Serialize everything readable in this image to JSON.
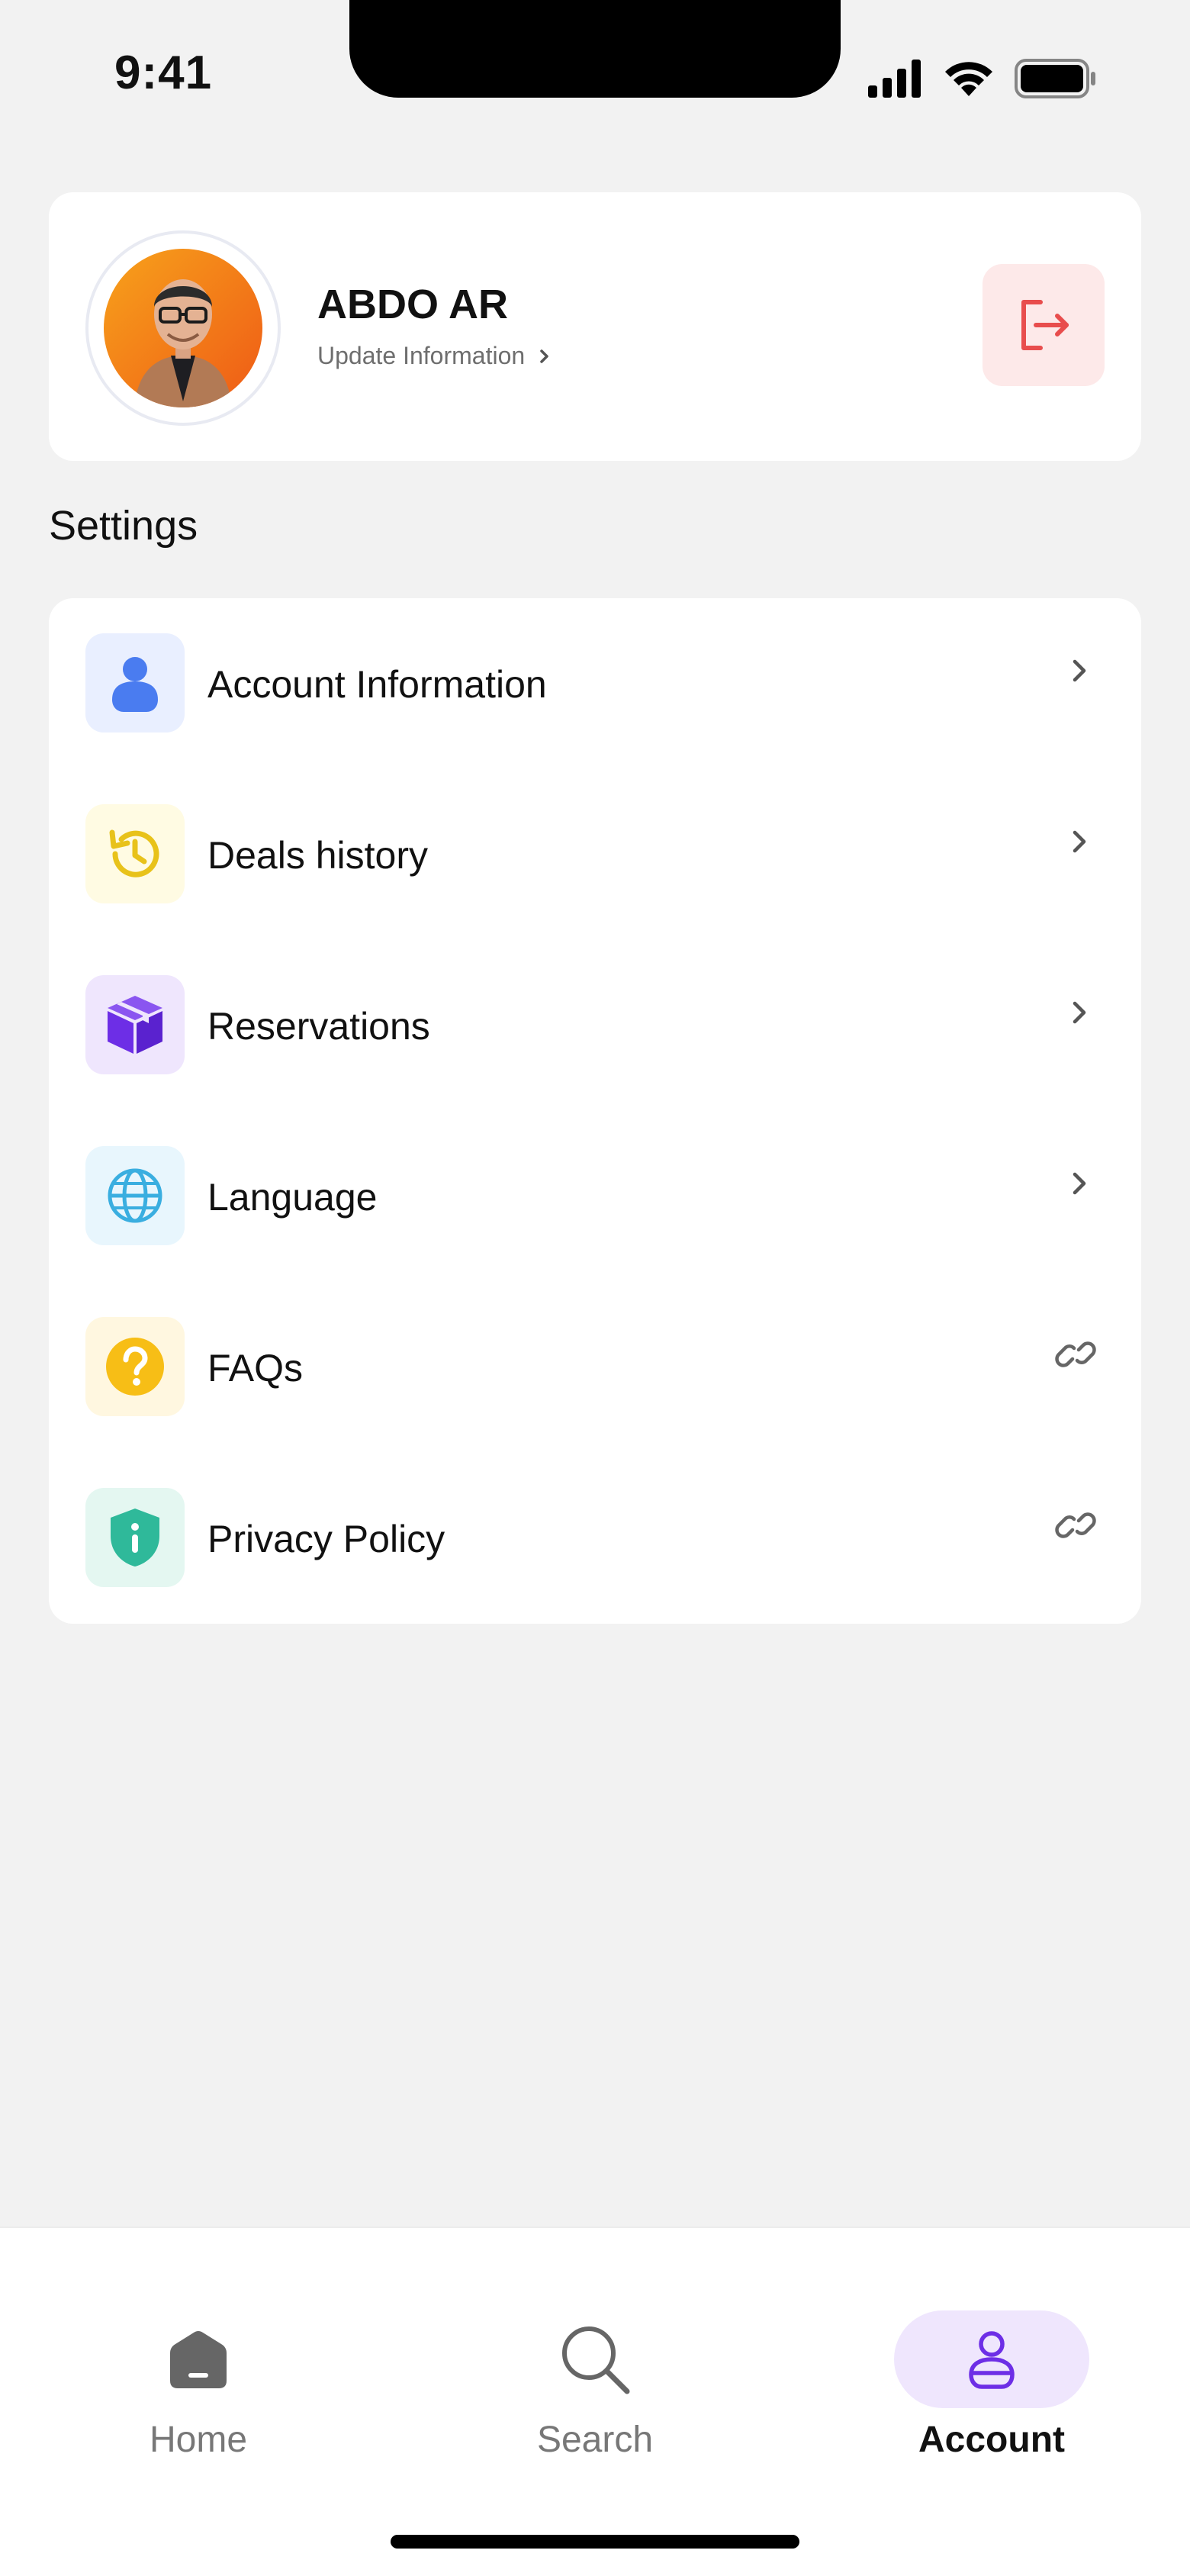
{
  "status_bar": {
    "time": "9:41"
  },
  "profile": {
    "name": "ABDO AR",
    "update_label": "Update Information"
  },
  "settings": {
    "title": "Settings",
    "items": [
      {
        "label": "Account Information",
        "icon": "user-icon",
        "trailing": "chevron-right-icon",
        "accent": "#4a7cf0",
        "tint": "#e9efff"
      },
      {
        "label": "Deals history",
        "icon": "history-icon",
        "trailing": "chevron-right-icon",
        "accent": "#e8c21a",
        "tint": "#fffbe3"
      },
      {
        "label": "Reservations",
        "icon": "box-icon",
        "trailing": "chevron-right-icon",
        "accent": "#6d2ee6",
        "tint": "#efe6fd"
      },
      {
        "label": "Language",
        "icon": "globe-icon",
        "trailing": "chevron-right-icon",
        "accent": "#3aaee0",
        "tint": "#e8f6fd"
      },
      {
        "label": "FAQs",
        "icon": "question-icon",
        "trailing": "link-icon",
        "accent": "#f7be16",
        "tint": "#fff7e0"
      },
      {
        "label": "Privacy Policy",
        "icon": "shield-info-icon",
        "trailing": "link-icon",
        "accent": "#2fb99a",
        "tint": "#e4f7f1"
      }
    ]
  },
  "bottom_nav": {
    "active": "Account",
    "items": [
      {
        "label": "Home",
        "icon": "home-icon"
      },
      {
        "label": "Search",
        "icon": "search-icon"
      },
      {
        "label": "Account",
        "icon": "user-outline-icon"
      }
    ]
  },
  "colors": {
    "background": "#f2f2f2",
    "logout_red": "#e84d4d",
    "logout_bg": "#fde9e9",
    "nav_active_bg": "#efe6fd",
    "nav_active_icon": "#6d2ee6"
  }
}
